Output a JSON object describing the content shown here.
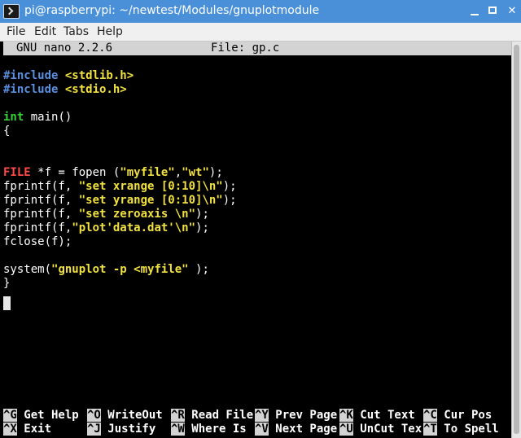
{
  "window": {
    "title": "pi@raspberrypi: ~/newtest/Modules/gnuplotmodule"
  },
  "menu": [
    "File",
    "Edit",
    "Tabs",
    "Help"
  ],
  "nano": {
    "version": "GNU nano 2.2.6",
    "file": "File: gp.c"
  },
  "code": {
    "l1a": "#include ",
    "l1b": "<stdlib.h>",
    "l2a": "#include ",
    "l2b": "<stdio.h>",
    "l3a": "int",
    "l3b": " main()",
    "l4": "{",
    "l5a": "FILE",
    "l5b": " *f = fopen (",
    "l5c": "\"myfile\"",
    "l5d": ",",
    "l5e": "\"wt\"",
    "l5f": ");",
    "l6a": "fprintf(f, ",
    "l6b": "\"set xrange [0:10]\\n\"",
    "l6c": ");",
    "l7a": "fprintf(f, ",
    "l7b": "\"set yrange [0:10]\\n\"",
    "l7c": ");",
    "l8a": "fprintf(f, ",
    "l8b": "\"set zeroaxis \\n\"",
    "l8c": ");",
    "l9a": "fprintf(f,",
    "l9b": "\"plot'data.dat'\\n\"",
    "l9c": ");",
    "l10": "fclose(f);",
    "l11a": "system(",
    "l11b": "\"gnuplot -p <myfile\"",
    "l11c": " );",
    "l12": "}"
  },
  "shortcuts": {
    "r1": [
      {
        "key": "^G",
        "label": " Get Help "
      },
      {
        "key": "^O",
        "label": " WriteOut "
      },
      {
        "key": "^R",
        "label": " Read File"
      },
      {
        "key": "^Y",
        "label": " Prev Page"
      },
      {
        "key": "^K",
        "label": " Cut Text "
      },
      {
        "key": "^C",
        "label": " Cur Pos"
      }
    ],
    "r2": [
      {
        "key": "^X",
        "label": " Exit     "
      },
      {
        "key": "^J",
        "label": " Justify  "
      },
      {
        "key": "^W",
        "label": " Where Is "
      },
      {
        "key": "^V",
        "label": " Next Page"
      },
      {
        "key": "^U",
        "label": " UnCut Tex"
      },
      {
        "key": "^T",
        "label": " To Spell"
      }
    ]
  },
  "colors": {
    "titlebar": "#4a90d9",
    "preprocessor": "#5a8fe0",
    "string": "#f0e040",
    "type": "#38d038",
    "file_type": "#ff4a4a"
  }
}
